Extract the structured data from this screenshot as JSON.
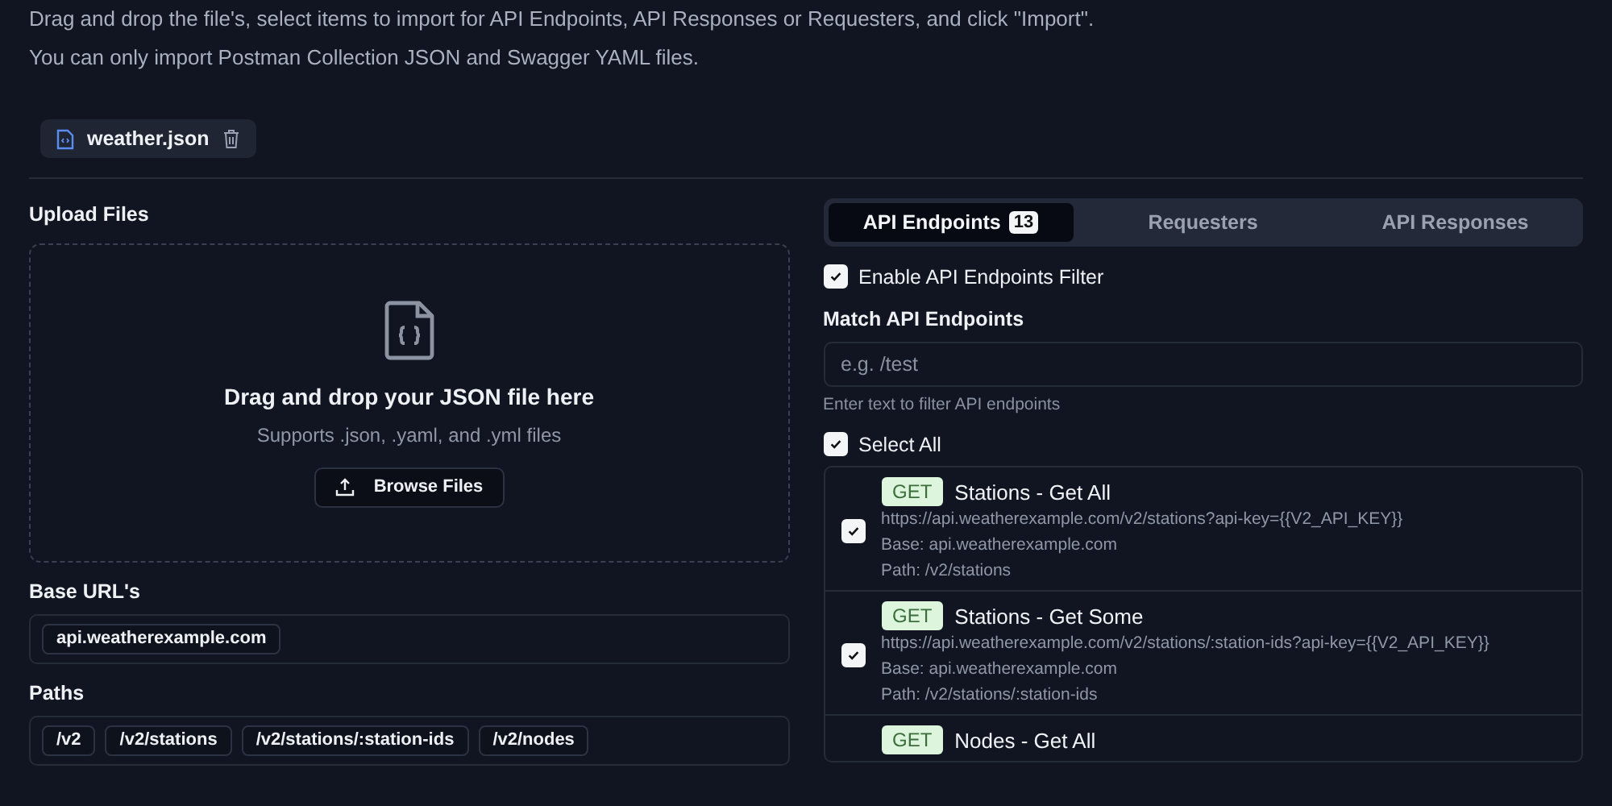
{
  "description": [
    "Drag and drop the file's, select items to import for API Endpoints, API Responses or Requesters, and click \"Import\".",
    "You can only import Postman Collection JSON and Swagger YAML files."
  ],
  "file_chip": {
    "name": "weather.json"
  },
  "upload": {
    "title": "Upload Files",
    "drop_title": "Drag and drop your JSON file here",
    "drop_hint": "Supports .json, .yaml, and .yml files",
    "browse_button": "Browse Files"
  },
  "base_urls": {
    "title": "Base URL's",
    "items": [
      "api.weatherexample.com"
    ]
  },
  "paths": {
    "title": "Paths",
    "items": [
      "/v2",
      "/v2/stations",
      "/v2/stations/:station-ids",
      "/v2/nodes"
    ]
  },
  "tabs": [
    {
      "label": "API Endpoints",
      "badge": "13",
      "selected": true
    },
    {
      "label": "Requesters",
      "selected": false
    },
    {
      "label": "API Responses",
      "selected": false
    }
  ],
  "filter": {
    "label": "Enable API Endpoints Filter",
    "checked": true
  },
  "match": {
    "label": "Match API Endpoints",
    "placeholder": "e.g. /test",
    "hint": "Enter text to filter API endpoints"
  },
  "select_all": {
    "label": "Select All",
    "checked": true
  },
  "endpoints": [
    {
      "method": "GET",
      "name": "Stations - Get All",
      "url": "https://api.weatherexample.com/v2/stations?api-key={{V2_API_KEY}}",
      "base": "Base: api.weatherexample.com",
      "path": "Path: /v2/stations",
      "checked": true
    },
    {
      "method": "GET",
      "name": "Stations - Get Some",
      "url": "https://api.weatherexample.com/v2/stations/:station-ids?api-key={{V2_API_KEY}}",
      "base": "Base: api.weatherexample.com",
      "path": "Path: /v2/stations/:station-ids",
      "checked": true
    },
    {
      "method": "GET",
      "name": "Nodes - Get All"
    }
  ]
}
